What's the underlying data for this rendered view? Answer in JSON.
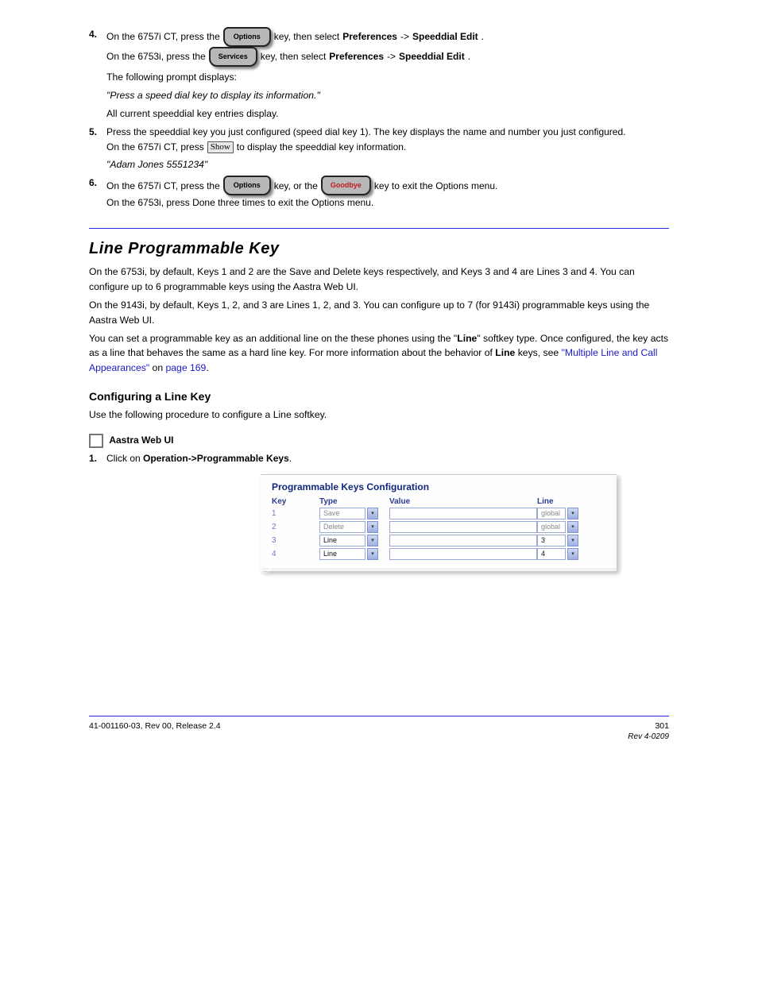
{
  "header": {
    "step4": {
      "num": "4.",
      "pre": "On the 6757i CT, press the ",
      "btn1": "Options",
      "mid": " key, then select ",
      "s1": "Preferences",
      "s1p": "->",
      "s2": "Speeddial Edit",
      "post": ".",
      "line2a": "On the 6753i, press the ",
      "btn2": "Services",
      "line2b": " key, then select ",
      "s3": "Preferences",
      "s3p": "->",
      "s4": "Speeddial Edit",
      "line2c": "."
    },
    "para5": "The following prompt displays:",
    "quote5": "\"Press a speed dial key to display its information.\"",
    "para6": "All current speeddial key entries display.",
    "step5": {
      "num": "5.",
      "txt_a": "Press the speeddial key you just configured (speed dial key 1). The key displays the name and number you just configured.",
      "txt_b_pre": "On the 6757i CT, press ",
      "sbtn": "Show",
      "txt_b_post": " to display the speeddial key information."
    },
    "quote6": "\"Adam Jones 5551234\"",
    "step6": {
      "num": "6.",
      "pre1": "On the 6757i CT, press the ",
      "btn1": "Options",
      "mid1": " key, or the ",
      "btn2": "Goodbye",
      "post1": " key to exit the Options menu.",
      "line2": "On the 6753i, press Done three times to exit the Options menu."
    }
  },
  "section": {
    "title": "Line Programmable Key",
    "p1": "On the 6753i, by default, Keys 1 and 2 are the Save and Delete keys respectively, and Keys 3 and 4 are Lines 3 and 4. You can configure up to 6 programmable keys using the Aastra Web UI.",
    "p2": "On the 9143i, by default, Keys 1, 2, and 3 are Lines 1, 2, and 3. You can configure up to 7 (for 9143i) programmable keys using the Aastra Web UI.",
    "p3a": "You can set a programmable key as an additional line on the these phones using the \"",
    "p3b": "Line",
    "p3c": "\" softkey type. Once configured, the key acts as a line that behaves the same as a hard line key. For more information about the behavior of ",
    "p3d": "Line",
    "p3e": " keys, see ",
    "p3f": "\"Multiple Line and Call Appearances\"",
    "p3g": " on ",
    "p3h": "page 169",
    "p3i": "."
  },
  "config": {
    "heading": "Configuring a Line Key",
    "lead": "Use the following procedure to configure a Line softkey.",
    "webui": "Aastra Web UI",
    "step1_num": "1.",
    "step1_pre": "Click on ",
    "step1_link": "Operation->Programmable Keys",
    "step1_post": ".",
    "screenshot": {
      "title": "Programmable Keys Configuration",
      "cols": {
        "key": "Key",
        "type": "Type",
        "value": "Value",
        "line": "Line"
      },
      "rows": [
        {
          "key": "1",
          "type": "Save",
          "type_enabled": false,
          "line": "global",
          "line_enabled": false
        },
        {
          "key": "2",
          "type": "Delete",
          "type_enabled": false,
          "line": "global",
          "line_enabled": false
        },
        {
          "key": "3",
          "type": "Line",
          "type_enabled": true,
          "line": "3",
          "line_enabled": true
        },
        {
          "key": "4",
          "type": "Line",
          "type_enabled": true,
          "line": "4",
          "line_enabled": true
        }
      ]
    }
  },
  "footer": {
    "left": "41-001160-03, Rev 00, Release 2.4",
    "right_num": "301",
    "right_rev": "Rev 4-0209"
  }
}
